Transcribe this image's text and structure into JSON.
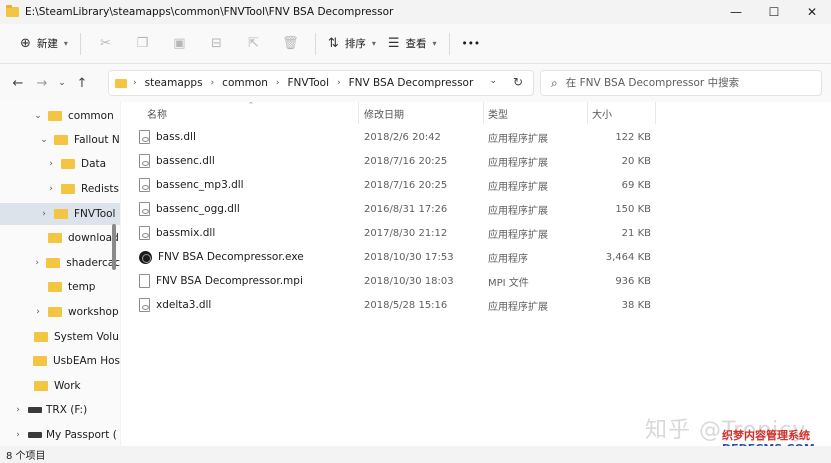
{
  "window": {
    "title": "E:\\SteamLibrary\\steamapps\\common\\FNVTool\\FNV BSA Decompressor",
    "minimize": "—",
    "maximize": "☐",
    "close": "✕"
  },
  "toolbar": {
    "new_label": "新建",
    "sort_label": "排序",
    "view_label": "查看",
    "more_label": "•••"
  },
  "address": {
    "breadcrumbs": [
      "steamapps",
      "common",
      "FNVTool",
      "FNV BSA Decompressor"
    ],
    "search_placeholder": "在 FNV BSA Decompressor 中搜索"
  },
  "nav": {
    "items": [
      {
        "label": "common",
        "arrow": "⌄",
        "type": "folder"
      },
      {
        "label": "Fallout N",
        "arrow": "⌄",
        "type": "folder"
      },
      {
        "label": "Data",
        "arrow": "›",
        "type": "folder"
      },
      {
        "label": "Redists",
        "arrow": "›",
        "type": "folder"
      },
      {
        "label": "FNVTool",
        "arrow": "›",
        "type": "folder"
      },
      {
        "label": "download",
        "arrow": "",
        "type": "folder"
      },
      {
        "label": "shadercac",
        "arrow": "›",
        "type": "folder"
      },
      {
        "label": "temp",
        "arrow": "",
        "type": "folder"
      },
      {
        "label": "workshop",
        "arrow": "›",
        "type": "folder"
      },
      {
        "label": "System Volu",
        "arrow": "",
        "type": "folder"
      },
      {
        "label": "UsbEAm Hos",
        "arrow": "",
        "type": "folder"
      },
      {
        "label": "Work",
        "arrow": "",
        "type": "folder"
      },
      {
        "label": "TRX (F:)",
        "arrow": "›",
        "type": "drive"
      },
      {
        "label": "My Passport (",
        "arrow": "›",
        "type": "drive"
      }
    ]
  },
  "columns": {
    "name": "名称",
    "modified": "修改日期",
    "type": "类型",
    "size": "大小"
  },
  "files": [
    {
      "name": "bass.dll",
      "modified": "2018/2/6 20:42",
      "type": "应用程序扩展",
      "size": "122 KB",
      "icon": "dll-icon"
    },
    {
      "name": "bassenc.dll",
      "modified": "2018/7/16 20:25",
      "type": "应用程序扩展",
      "size": "20 KB",
      "icon": "dll-icon"
    },
    {
      "name": "bassenc_mp3.dll",
      "modified": "2018/7/16 20:25",
      "type": "应用程序扩展",
      "size": "69 KB",
      "icon": "dll-icon"
    },
    {
      "name": "bassenc_ogg.dll",
      "modified": "2016/8/31 17:26",
      "type": "应用程序扩展",
      "size": "150 KB",
      "icon": "dll-icon"
    },
    {
      "name": "bassmix.dll",
      "modified": "2017/8/30 21:12",
      "type": "应用程序扩展",
      "size": "21 KB",
      "icon": "dll-icon"
    },
    {
      "name": "FNV BSA Decompressor.exe",
      "modified": "2018/10/30 17:53",
      "type": "应用程序",
      "size": "3,464 KB",
      "icon": "exe-icon"
    },
    {
      "name": "FNV BSA Decompressor.mpi",
      "modified": "2018/10/30 18:03",
      "type": "MPI 文件",
      "size": "936 KB",
      "icon": "file-icon"
    },
    {
      "name": "xdelta3.dll",
      "modified": "2018/5/28 15:16",
      "type": "应用程序扩展",
      "size": "38 KB",
      "icon": "dll-icon"
    }
  ],
  "status": {
    "count": "8 个项目"
  },
  "watermark": {
    "text": "知乎 @Tropicy",
    "site1": "织梦内容管理系统",
    "site2": "DEDECMS.COM"
  },
  "colors": {
    "folder": "#f4c542",
    "selected": "#dde3ea"
  }
}
